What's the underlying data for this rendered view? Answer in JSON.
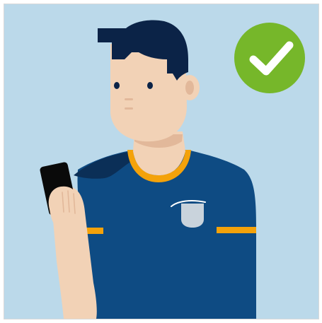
{
  "illustration": {
    "subject": "person-holding-phone",
    "status_icon": "checkmark-icon",
    "colors": {
      "background": "#BBD9EA",
      "frame_border": "#D9D9D9",
      "shirt": "#0E4B83",
      "shirt_shadow": "#0B2F57",
      "shirt_trim": "#F4A20A",
      "skin": "#F2D2B6",
      "skin_shadow": "#E2B89A",
      "hair": "#0B2347",
      "phone": "#0A0A0A",
      "pocket_badge": "#C9D3DC",
      "check_circle": "#76B72A",
      "check_mark": "#FFFFFF"
    }
  }
}
